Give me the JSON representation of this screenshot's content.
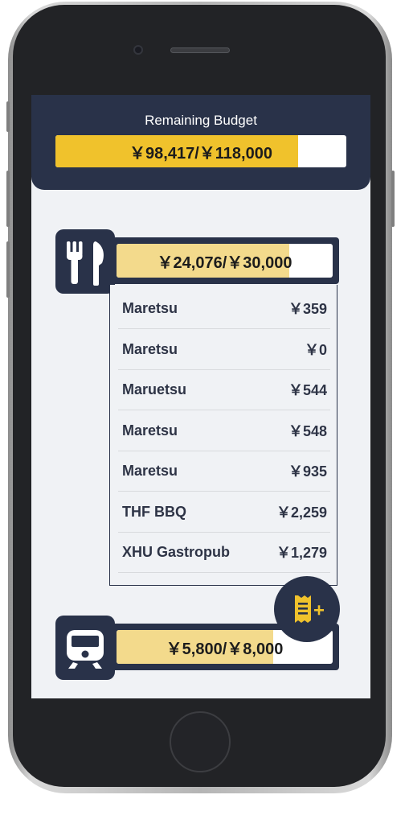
{
  "header": {
    "title": "Remaining Budget",
    "amount_text": "￥98,417/￥118,000",
    "fill_fraction": 0.834
  },
  "categories": [
    {
      "icon": "fork-knife-icon",
      "amount_text": "￥24,076/￥30,000",
      "fill_fraction": 0.8,
      "transactions": [
        {
          "name": "Maretsu",
          "amount": "￥359"
        },
        {
          "name": "Maretsu",
          "amount": "￥0"
        },
        {
          "name": "Maruetsu",
          "amount": "￥544"
        },
        {
          "name": "Maretsu",
          "amount": "￥548"
        },
        {
          "name": "Maretsu",
          "amount": "￥935"
        },
        {
          "name": "THF BBQ",
          "amount": "￥2,259"
        },
        {
          "name": "XHU Gastropub",
          "amount": "￥1,279"
        }
      ]
    },
    {
      "icon": "train-icon",
      "amount_text": "￥5,800/￥8,000",
      "fill_fraction": 0.725
    }
  ],
  "fab": {
    "icon": "add-receipt-icon"
  },
  "colors": {
    "navy": "#293249",
    "accent_yellow": "#f0c22c",
    "light_yellow": "#f3da8c",
    "background": "#f0f2f5"
  }
}
